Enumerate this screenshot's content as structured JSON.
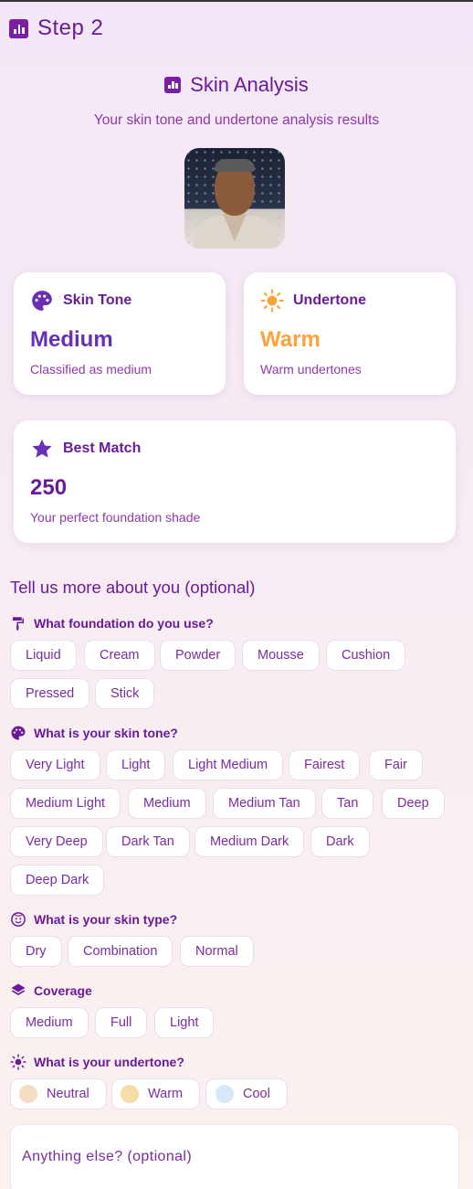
{
  "step": {
    "title": "Step 2",
    "icon": "chart-icon"
  },
  "analysis": {
    "title": "Skin Analysis",
    "subtitle": "Your skin tone and undertone analysis results",
    "photo_icon": "user-photo"
  },
  "cards": {
    "skin_tone": {
      "label": "Skin Tone",
      "value": "Medium",
      "desc": "Classified as medium",
      "icon": "palette-icon",
      "color": "#6a2fb8"
    },
    "undertone": {
      "label": "Undertone",
      "value": "Warm",
      "desc": "Warm undertones",
      "icon": "sun-icon",
      "color": "#ffa23a"
    },
    "best_match": {
      "label": "Best Match",
      "value": "250",
      "desc": "Your perfect foundation shade",
      "icon": "star-icon",
      "color": "#6a1b9a"
    }
  },
  "more": {
    "title": "Tell us more about you (optional)",
    "foundation": {
      "question": "What foundation do you use?",
      "icon": "paint-roller-icon",
      "options": [
        "Liquid",
        "Cream",
        "Powder",
        "Mousse",
        "Cushion",
        "Pressed",
        "Stick"
      ]
    },
    "skin_tone": {
      "question": "What is your skin tone?",
      "icon": "palette-icon",
      "options": [
        "Very Light",
        "Light",
        "Light Medium",
        "Fairest",
        "Fair",
        "Medium Light",
        "Medium",
        "Medium Tan",
        "Tan",
        "Deep",
        "Very Deep",
        "Dark Tan",
        "Medium Dark",
        "Dark",
        "Deep Dark"
      ]
    },
    "skin_type": {
      "question": "What is your skin type?",
      "icon": "face-icon",
      "options": [
        "Dry",
        "Combination",
        "Normal"
      ]
    },
    "coverage": {
      "question": "Coverage",
      "icon": "layers-icon",
      "options": [
        "Medium",
        "Full",
        "Light"
      ]
    },
    "undertone": {
      "question": "What is your undertone?",
      "icon": "sun-icon",
      "options": [
        {
          "label": "Neutral",
          "color": "#f3dcc2"
        },
        {
          "label": "Warm",
          "color": "#f6dca6"
        },
        {
          "label": "Cool",
          "color": "#d6e8f7"
        }
      ]
    },
    "notes": {
      "placeholder": "Anything else? (optional)"
    }
  }
}
